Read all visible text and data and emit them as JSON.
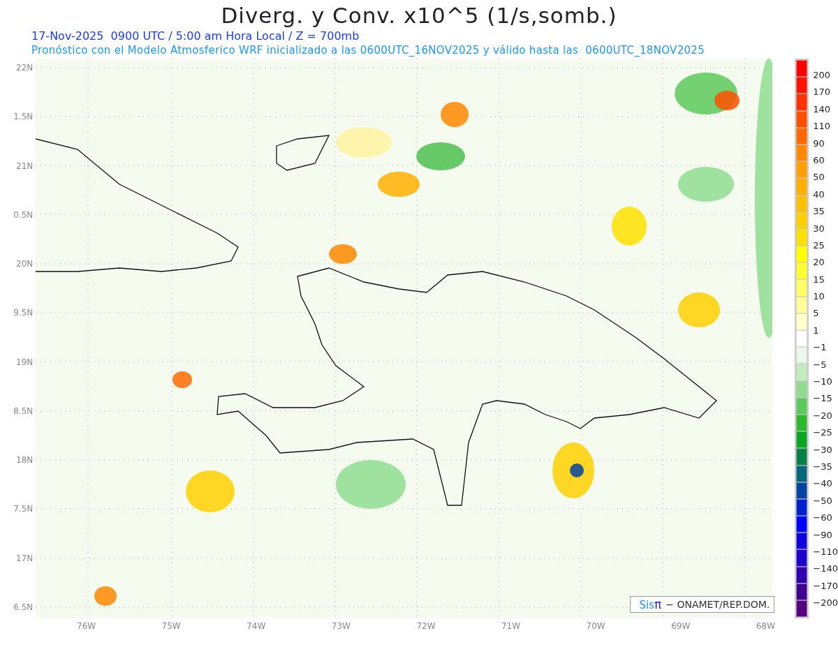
{
  "title": "Diverg. y Conv. x10^5 (1/s,somb.)",
  "subtitle": "17-Nov-2025  0900 UTC / 5:00 am Hora Local / Z = 700mb",
  "forecast_note": "Pronóstico con el Modelo Atmosferico WRF inicializado a las 0600UTC_16NOV2025 y válido hasta las  0600UTC_18NOV2025",
  "map": {
    "y_axis": [
      "22N",
      "1.5N",
      "21N",
      "0.5N",
      "20N",
      "9.5N",
      "19N",
      "8.5N",
      "18N",
      "7.5N",
      "17N",
      "6.5N"
    ],
    "x_axis": [
      "76W",
      "75W",
      "74W",
      "73W",
      "72W",
      "71W",
      "70W",
      "69W",
      "68W"
    ],
    "credit": {
      "logo": "Sis",
      "logo_symbol": "π",
      "text": "− ONAMET/REP.DOM."
    }
  },
  "colorbar": {
    "segments": [
      {
        "color": "#ff0000"
      },
      {
        "color": "#ff1000"
      },
      {
        "color": "#ff3300"
      },
      {
        "color": "#ff5000"
      },
      {
        "color": "#ff6a00"
      },
      {
        "color": "#ff8800"
      },
      {
        "color": "#ffa000"
      },
      {
        "color": "#ffb000"
      },
      {
        "color": "#ffc000"
      },
      {
        "color": "#ffd000"
      },
      {
        "color": "#ffe000"
      },
      {
        "color": "#ffff00"
      },
      {
        "color": "#ffff33"
      },
      {
        "color": "#ffff66"
      },
      {
        "color": "#ffff99"
      },
      {
        "color": "#ffffcc"
      },
      {
        "color": "#ffffff"
      },
      {
        "color": "#ebf7eb"
      },
      {
        "color": "#c0ecc0"
      },
      {
        "color": "#8fdc8f"
      },
      {
        "color": "#5cc95c"
      },
      {
        "color": "#2eb82e"
      },
      {
        "color": "#08a622"
      },
      {
        "color": "#088048"
      },
      {
        "color": "#06667a"
      },
      {
        "color": "#0444a0"
      },
      {
        "color": "#0022cc"
      },
      {
        "color": "#0000ff"
      },
      {
        "color": "#1000e0"
      },
      {
        "color": "#2000cc"
      },
      {
        "color": "#3000b0"
      },
      {
        "color": "#400090"
      },
      {
        "color": "#550080"
      }
    ],
    "labels": [
      "200",
      "170",
      "140",
      "110",
      "90",
      "60",
      "50",
      "40",
      "35",
      "30",
      "25",
      "20",
      "15",
      "10",
      "5",
      "1",
      "−1",
      "−5",
      "−10",
      "−15",
      "−20",
      "−25",
      "−30",
      "−35",
      "−40",
      "−50",
      "−60",
      "−90",
      "−110",
      "−140",
      "−170",
      "−200"
    ]
  }
}
